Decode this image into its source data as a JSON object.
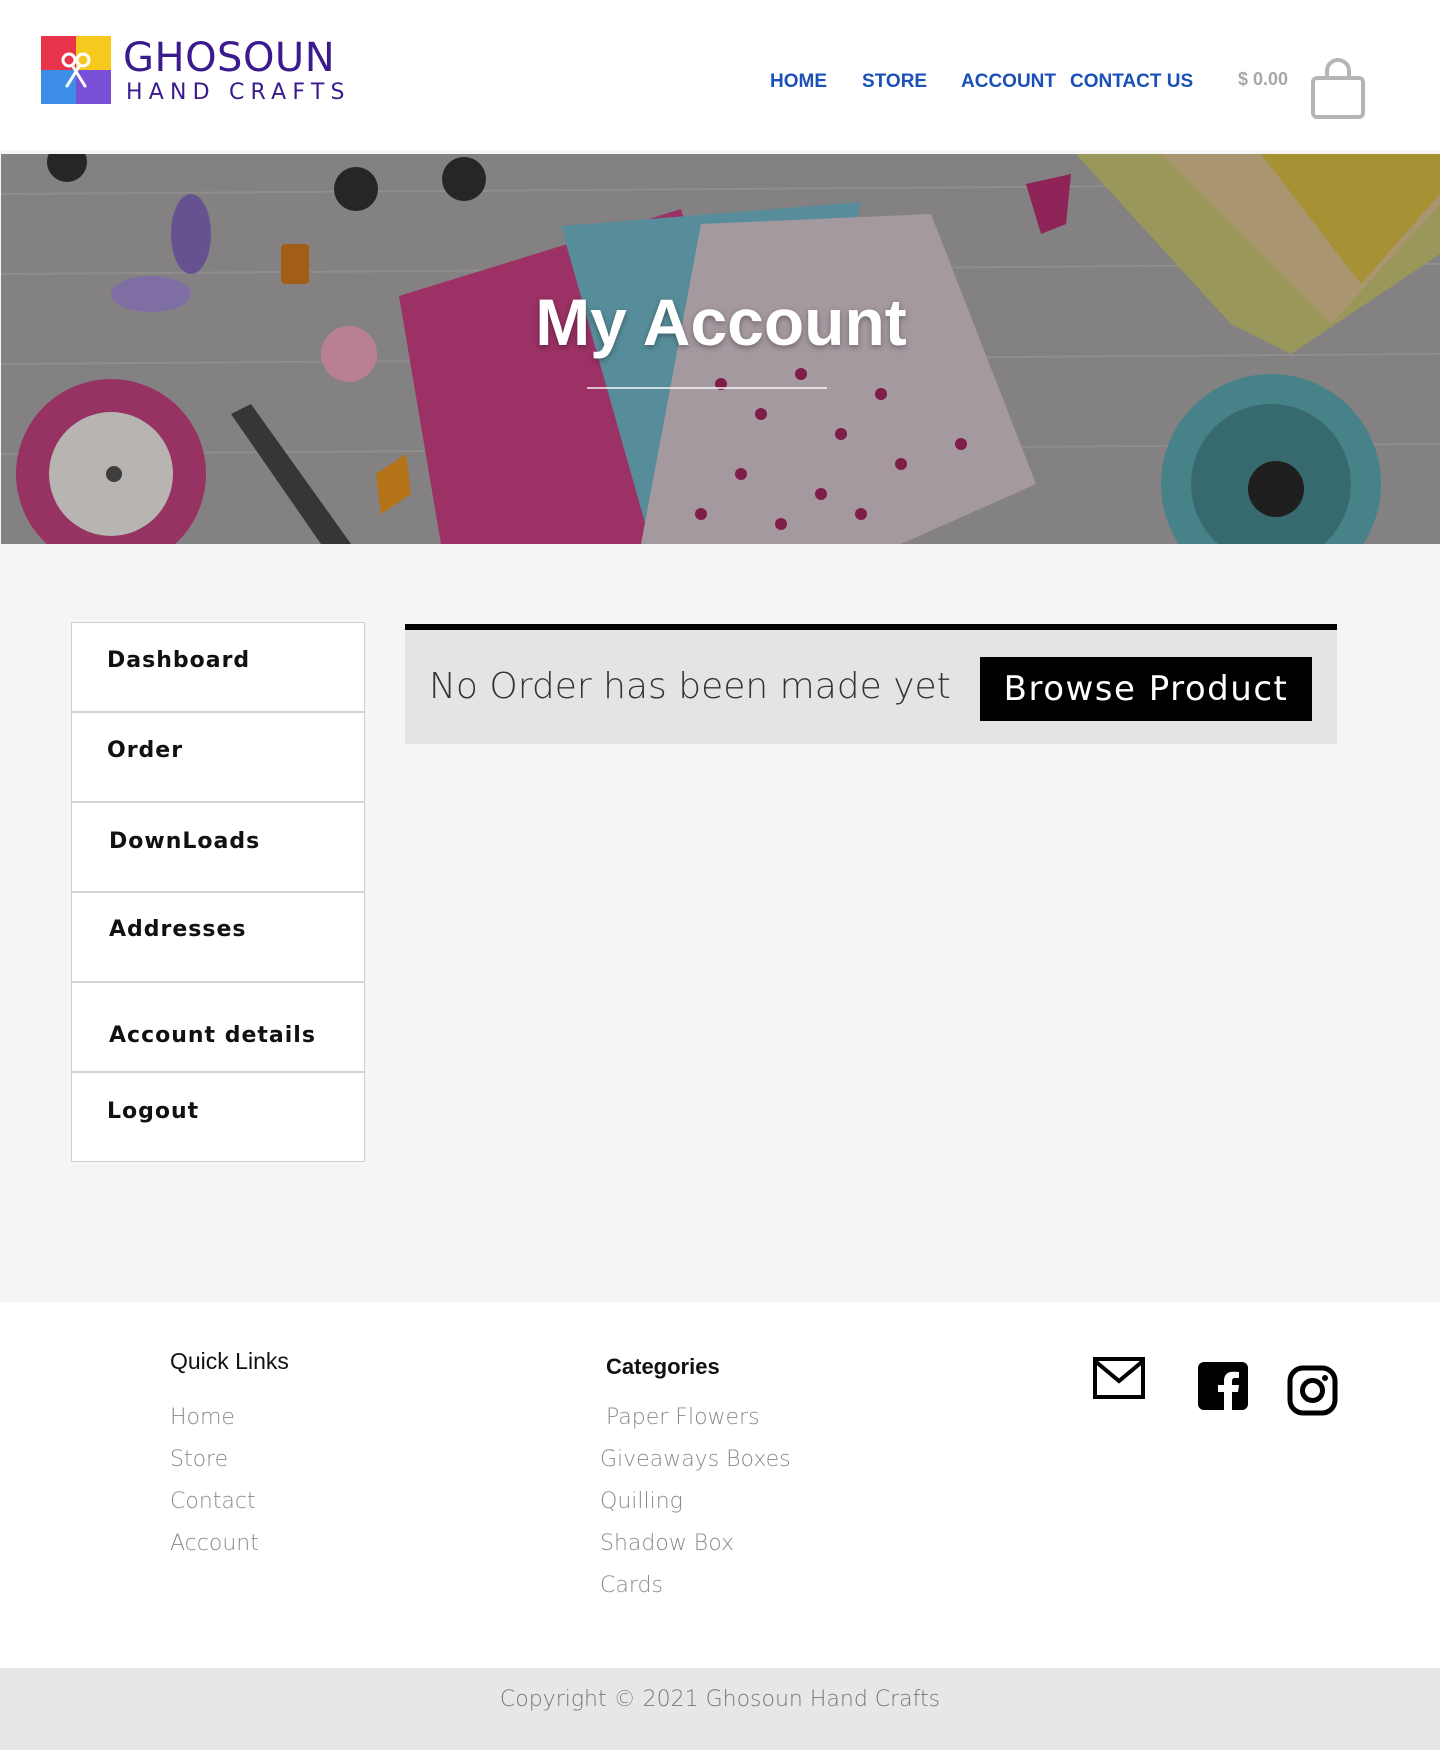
{
  "brand": {
    "name_line1": "GHOSOUN",
    "name_line2": "HAND CRAFTS",
    "logo_colors": [
      "#e8344a",
      "#f7c81e",
      "#3d8ee8",
      "#7a4fd8"
    ]
  },
  "nav": {
    "home": "HOME",
    "store": "STORE",
    "account": "ACCOUNT",
    "contact": "CONTACT US"
  },
  "cart": {
    "total": "$ 0.00",
    "icon": "shopping-bag-icon"
  },
  "hero": {
    "title": "My Account"
  },
  "account_menu": [
    {
      "label": "Dashboard"
    },
    {
      "label": "Order"
    },
    {
      "label": "DownLoads"
    },
    {
      "label": "Addresses"
    },
    {
      "label": "Account details"
    },
    {
      "label": "Logout"
    }
  ],
  "orders": {
    "message": "No Order has been made yet",
    "button_label": "Browse Product"
  },
  "footer": {
    "quick_links_heading": "Quick Links",
    "quick_links": [
      "Home",
      "Store",
      "Contact",
      "Account"
    ],
    "categories_heading": "Categories",
    "categories": [
      "Paper Flowers",
      "Giveaways Boxes",
      "Quilling",
      "Shadow Box",
      "Cards"
    ],
    "social": [
      "mail-icon",
      "facebook-icon",
      "instagram-icon"
    ],
    "copyright": "Copyright © 2021 Ghosoun Hand Crafts"
  },
  "colors": {
    "nav_link": "#1a50b8",
    "brand_purple": "#3a1a8c",
    "page_bg": "#f5f5f5",
    "button_bg": "#000000"
  }
}
